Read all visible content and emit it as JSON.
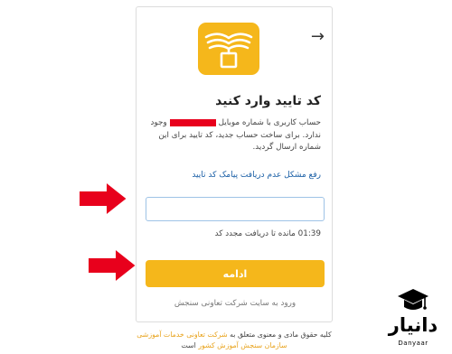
{
  "header": {
    "back_arrow_glyph": "→"
  },
  "logo": {
    "icon": "open-book-icon",
    "bg_color": "#f5b71b"
  },
  "page": {
    "title": "کد تایید وارد کنید",
    "description_part1": "حساب کاربری با شماره موبایل",
    "description_part2": "وجود ندارد. برای ساخت حساب جدید، کد تایید برای این شماره ارسال گردید."
  },
  "links": {
    "sms_problem": "رفع مشکل عدم دریافت پیامک کد تایید",
    "back_to_site": "ورود به سایت شرکت تعاونی سنجش"
  },
  "code_input": {
    "value": "",
    "placeholder": ""
  },
  "timer": {
    "text": "01:39 مانده تا دریافت مجدد کد"
  },
  "buttons": {
    "continue_label": "ادامه",
    "continue_color": "#f5b71b"
  },
  "footer": {
    "text_before": "کلیه حقوق مادی و معنوی متعلق به",
    "org_name": "شرکت تعاونی خدمات آموزشی سازمان سنجش آموزش کشور",
    "text_after": "است"
  },
  "watermark": {
    "text": "دانیار",
    "sub": "Danyaar",
    "icon": "graduation-cap-icon"
  },
  "annotations": {
    "arrow_color": "#e8001c"
  }
}
